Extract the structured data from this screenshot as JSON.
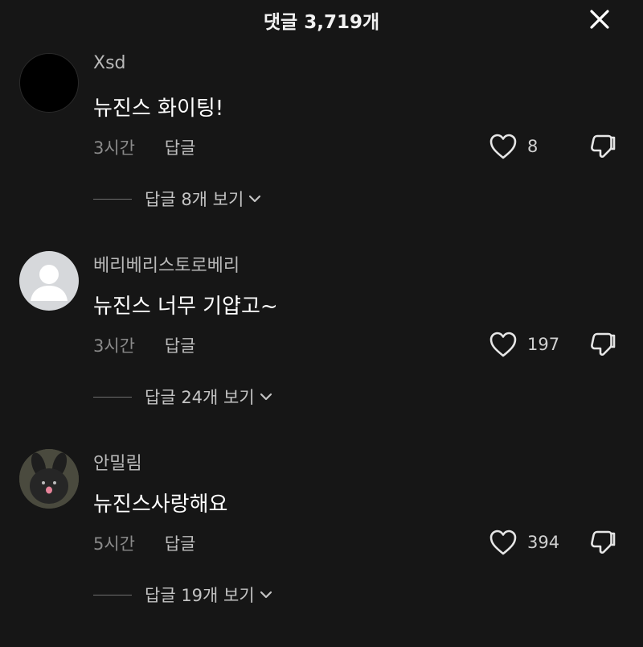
{
  "header": {
    "title": "댓글 3,719개",
    "close_icon": "close-icon"
  },
  "comments": [
    {
      "avatar": "black-avatar",
      "username": "Xsd",
      "text": "뉴진스 화이팅!",
      "time": "3시간",
      "reply_label": "답글",
      "likes": "8",
      "view_replies": "답글 8개 보기"
    },
    {
      "avatar": "default-person-avatar",
      "username": "베리베리스토로베리",
      "text": "뉴진스 너무 기얍고~",
      "time": "3시간",
      "reply_label": "답글",
      "likes": "197",
      "view_replies": "답글 24개 보기"
    },
    {
      "avatar": "plush-toy-avatar",
      "username": "안밀림",
      "text": "뉴진스사랑해요",
      "time": "5시간",
      "reply_label": "답글",
      "likes": "394",
      "view_replies": "답글 19개 보기"
    }
  ],
  "colors": {
    "background": "#161616",
    "text_primary": "#ffffff",
    "text_secondary": "#8a8a8a"
  }
}
